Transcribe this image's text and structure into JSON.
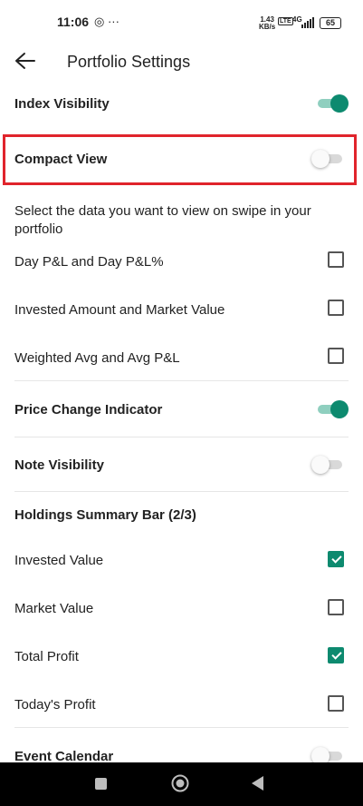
{
  "status_bar": {
    "time": "11:06",
    "icons": "◎ ···",
    "speed_value": "1.43",
    "speed_unit": "KB/s",
    "network": "4G",
    "battery": "65"
  },
  "header": {
    "title": "Portfolio Settings",
    "back_icon": "arrow-left-icon"
  },
  "settings": {
    "index_visibility": {
      "label": "Index Visibility",
      "enabled": true
    },
    "compact_view": {
      "label": "Compact View",
      "enabled": false
    },
    "swipe_description": "Select the data you want to view on swipe in your portfolio",
    "swipe_options": [
      {
        "label": "Day P&L and Day P&L%",
        "checked": false
      },
      {
        "label": "Invested Amount and Market Value",
        "checked": false
      },
      {
        "label": "Weighted Avg and Avg P&L",
        "checked": false
      }
    ],
    "price_change_indicator": {
      "label": "Price Change Indicator",
      "enabled": true
    },
    "note_visibility": {
      "label": "Note Visibility",
      "enabled": false
    },
    "holdings_summary_bar": {
      "label": "Holdings Summary Bar (2/3)",
      "options": [
        {
          "label": "Invested Value",
          "checked": true
        },
        {
          "label": "Market Value",
          "checked": false
        },
        {
          "label": "Total Profit",
          "checked": true
        },
        {
          "label": "Today's Profit",
          "checked": false
        }
      ]
    },
    "event_calendar": {
      "label": "Event Calendar",
      "enabled": false
    }
  },
  "colors": {
    "accent": "#0d8a6f",
    "highlight": "#e0242c"
  },
  "nav_bar": [
    "recents-square-icon",
    "home-circle-icon",
    "back-triangle-icon"
  ]
}
